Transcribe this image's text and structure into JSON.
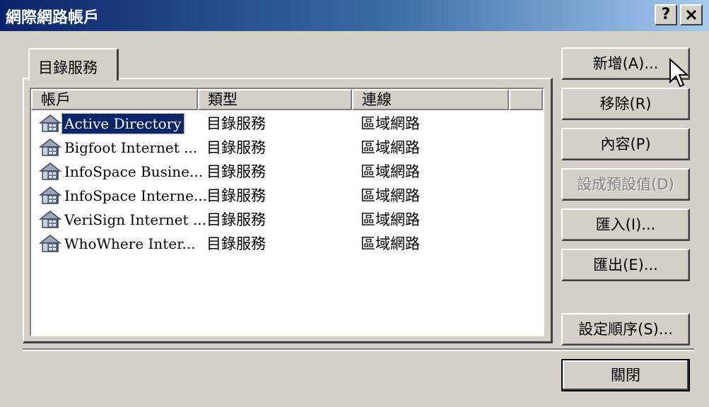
{
  "window": {
    "title": "網際網路帳戶",
    "help_button": "?",
    "close_button": "x"
  },
  "tabs": [
    {
      "label": "目錄服務",
      "selected": true
    }
  ],
  "list": {
    "columns": [
      "帳戶",
      "類型",
      "連線"
    ],
    "rows": [
      {
        "name": "Active Directory",
        "type": "目錄服務",
        "connection": "區域網路",
        "selected": true,
        "icon": "directory-service-icon"
      },
      {
        "name": "Bigfoot Internet ...",
        "type": "目錄服務",
        "connection": "區域網路",
        "icon": "directory-service-icon"
      },
      {
        "name": "InfoSpace Busine...",
        "type": "目錄服務",
        "connection": "區域網路",
        "icon": "directory-service-icon"
      },
      {
        "name": "InfoSpace Interne...",
        "type": "目錄服務",
        "connection": "區域網路",
        "icon": "directory-service-icon"
      },
      {
        "name": "VeriSign Internet ...",
        "type": "目錄服務",
        "connection": "區域網路",
        "icon": "directory-service-icon"
      },
      {
        "name": "WhoWhere Inter...",
        "type": "目錄服務",
        "connection": "區域網路",
        "icon": "directory-service-icon"
      }
    ]
  },
  "buttons": {
    "add": "新增(A)...",
    "remove": "移除(R)",
    "properties": "內容(P)",
    "set_default": "設成預設值(D)",
    "import": "匯入(I)...",
    "export": "匯出(E)...",
    "set_order": "設定順序(S)...",
    "close": "關閉"
  },
  "colors": {
    "face": "#d4d0c8",
    "title_gradient_start": "#0a246a",
    "selection": "#0a246a"
  }
}
